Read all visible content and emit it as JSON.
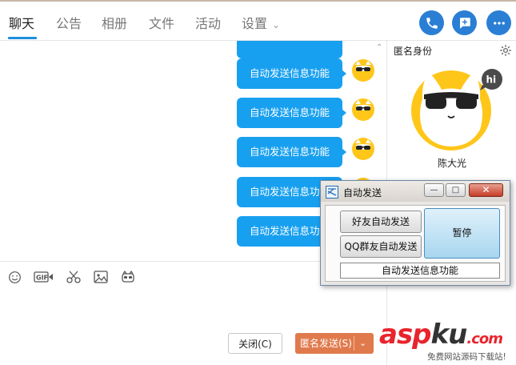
{
  "tabs": [
    {
      "label": "聊天"
    },
    {
      "label": "公告"
    },
    {
      "label": "相册"
    },
    {
      "label": "文件"
    },
    {
      "label": "活动"
    },
    {
      "label": "设置"
    }
  ],
  "top_actions": {
    "icons": [
      "phone-icon",
      "message-plus-icon",
      "more-icon"
    ],
    "color": "#2a7fd4"
  },
  "chat": {
    "messages": [
      {
        "text": ""
      },
      {
        "text": "自动发送信息功能"
      },
      {
        "text": "自动发送信息功能"
      },
      {
        "text": "自动发送信息功能"
      },
      {
        "text": "自动发送信息功能"
      },
      {
        "text": "自动发送信息功能"
      }
    ],
    "bubble_color": "#18a0f0"
  },
  "toolbar": {
    "icons": [
      "emoji-icon",
      "gif-icon",
      "scissors-icon",
      "image-icon",
      "game-icon"
    ]
  },
  "buttons": {
    "close": "关闭(C)",
    "send": "匿名发送(S)"
  },
  "side_panel": {
    "title": "匿名身份",
    "name": "陈大光",
    "badge": "hi"
  },
  "popup": {
    "title": "自动发送",
    "friend_button": "好友自动发送",
    "group_button": "QQ群友自动发送",
    "pause_button": "暂停",
    "message": "自动发送信息功能"
  },
  "watermark": {
    "brand_a": "asp",
    "brand_b": "ku",
    "brand_c": ".com",
    "subtitle": "免费网站源码下载站!"
  }
}
